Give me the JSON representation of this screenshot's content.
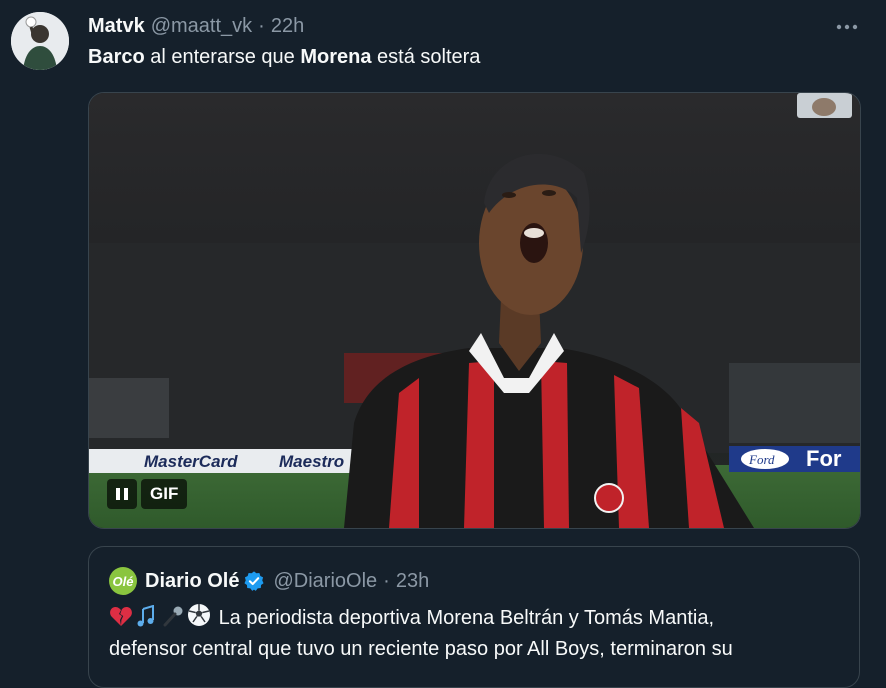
{
  "tweet": {
    "author_name": "Matvk",
    "author_handle": "@maatt_vk",
    "separator": "·",
    "time": "22h",
    "text_part1": "Barco",
    "text_part2": " al enterarse que ",
    "text_part3": "Morena",
    "text_part4": " está soltera",
    "more_icon": "more-horizontal-icon",
    "media": {
      "type": "GIF",
      "badge_label": "GIF",
      "banner_left": "MasterCard",
      "banner_mid": "Maestro",
      "banner_right_a": "Ford",
      "banner_right_b": "For"
    }
  },
  "quoted_tweet": {
    "logo_text": "Olé",
    "author_name": "Diario Olé",
    "author_handle": "@DiarioOle",
    "separator": "·",
    "time": "23h",
    "line1": "La periodista deportiva Morena Beltrán y Tomás Mantia,",
    "line2": "defensor central que tuvo un reciente paso por All Boys, terminaron su",
    "colors": {
      "logo": "#8ac53f",
      "verified": "#1d9bf0"
    }
  },
  "colors": {
    "background": "#15202b",
    "text_primary": "#f7f9f9",
    "text_secondary": "#8b98a5",
    "border": "#38444d"
  }
}
